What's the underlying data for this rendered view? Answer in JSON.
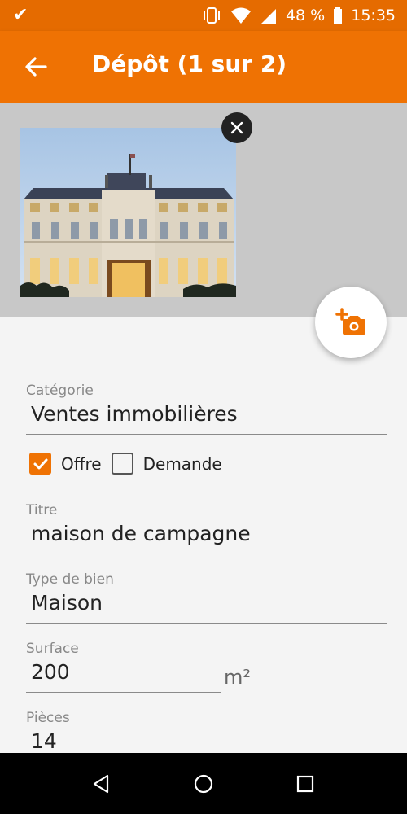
{
  "status_bar": {
    "battery_text": "48 %",
    "time": "15:35",
    "icons": [
      "download-done-icon",
      "vibrate-icon",
      "wifi-icon",
      "signal-icon",
      "battery-icon"
    ]
  },
  "app_bar": {
    "title": "Dépôt (1 sur 2)",
    "back_icon": "arrow-back-icon"
  },
  "photos": {
    "remove_icon": "close-icon",
    "add_photo_icon": "add-photo-icon"
  },
  "form": {
    "categorie": {
      "label": "Catégorie",
      "value": "Ventes immobilières"
    },
    "type_annonce": {
      "offre": {
        "label": "Offre",
        "checked": true
      },
      "demande": {
        "label": "Demande",
        "checked": false
      }
    },
    "titre": {
      "label": "Titre",
      "value": "maison de campagne"
    },
    "type_de_bien": {
      "label": "Type de bien",
      "value": "Maison"
    },
    "surface": {
      "label": "Surface",
      "value": "200",
      "unit": "m²"
    },
    "pieces": {
      "label": "Pièces",
      "value": "14"
    }
  },
  "colors": {
    "primary": "#ef7203",
    "status_bar": "#e56b00",
    "photo_background": "#c8c8c8"
  }
}
